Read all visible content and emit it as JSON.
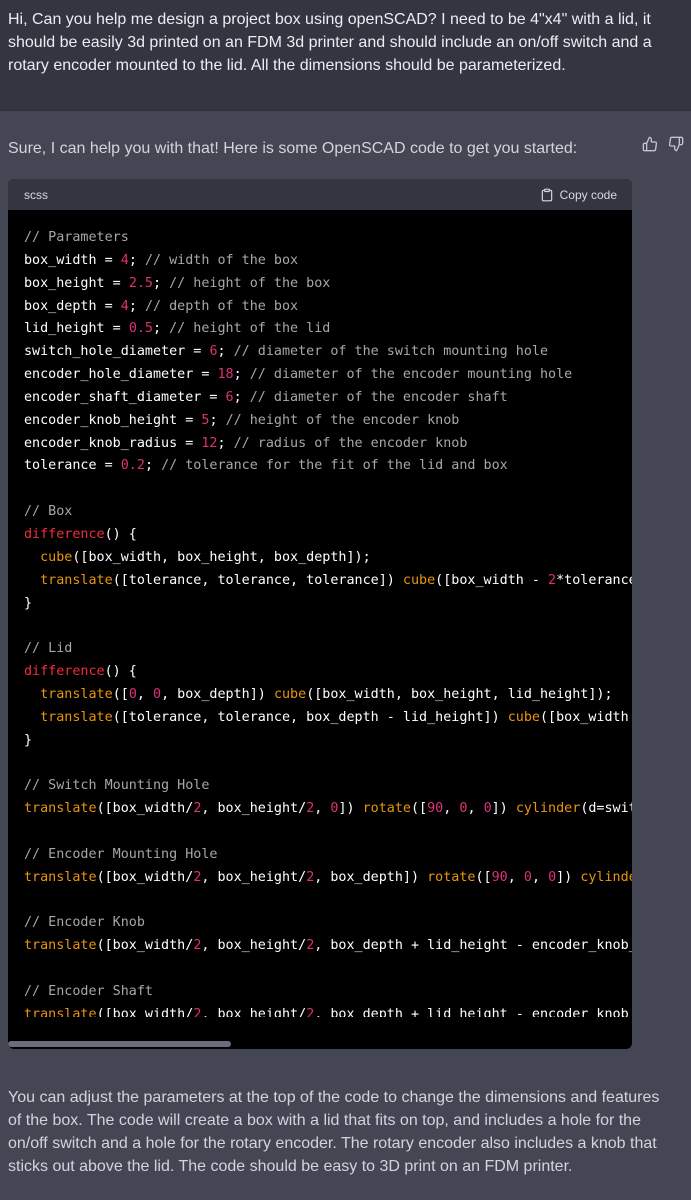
{
  "user_message": {
    "text": "Hi, Can you help me design a project box using openSCAD? I need to be 4\"x4\" with a lid, it should be easily 3d printed on an FDM 3d printer and should include an on/off switch and a rotary encoder mounted to the lid. All the dimensions should be parameterized."
  },
  "assistant": {
    "intro": "Sure, I can help you with that! Here is some OpenSCAD code to get you started:",
    "outro": "You can adjust the parameters at the top of the code to change the dimensions and features of the box. The code will create a box with a lid that fits on top, and includes a hole for the on/off switch and a hole for the rotary encoder. The rotary encoder also includes a knob that sticks out above the lid. The code should be easy to 3D print on an FDM printer."
  },
  "code_block": {
    "language": "scss",
    "copy_label": "Copy code",
    "lines": [
      [
        [
          "cm",
          "// Parameters"
        ]
      ],
      [
        [
          "t",
          "box_width = "
        ],
        [
          "num",
          "4"
        ],
        [
          "t",
          "; "
        ],
        [
          "cm",
          "// width of the box"
        ]
      ],
      [
        [
          "t",
          "box_height = "
        ],
        [
          "num",
          "2.5"
        ],
        [
          "t",
          "; "
        ],
        [
          "cm",
          "// height of the box"
        ]
      ],
      [
        [
          "t",
          "box_depth = "
        ],
        [
          "num",
          "4"
        ],
        [
          "t",
          "; "
        ],
        [
          "cm",
          "// depth of the box"
        ]
      ],
      [
        [
          "t",
          "lid_height = "
        ],
        [
          "num",
          "0.5"
        ],
        [
          "t",
          "; "
        ],
        [
          "cm",
          "// height of the lid"
        ]
      ],
      [
        [
          "t",
          "switch_hole_diameter = "
        ],
        [
          "num",
          "6"
        ],
        [
          "t",
          "; "
        ],
        [
          "cm",
          "// diameter of the switch mounting hole"
        ]
      ],
      [
        [
          "t",
          "encoder_hole_diameter = "
        ],
        [
          "num",
          "18"
        ],
        [
          "t",
          "; "
        ],
        [
          "cm",
          "// diameter of the encoder mounting hole"
        ]
      ],
      [
        [
          "t",
          "encoder_shaft_diameter = "
        ],
        [
          "num",
          "6"
        ],
        [
          "t",
          "; "
        ],
        [
          "cm",
          "// diameter of the encoder shaft"
        ]
      ],
      [
        [
          "t",
          "encoder_knob_height = "
        ],
        [
          "num",
          "5"
        ],
        [
          "t",
          "; "
        ],
        [
          "cm",
          "// height of the encoder knob"
        ]
      ],
      [
        [
          "t",
          "encoder_knob_radius = "
        ],
        [
          "num",
          "12"
        ],
        [
          "t",
          "; "
        ],
        [
          "cm",
          "// radius of the encoder knob"
        ]
      ],
      [
        [
          "t",
          "tolerance = "
        ],
        [
          "num",
          "0.2"
        ],
        [
          "t",
          "; "
        ],
        [
          "cm",
          "// tolerance for the fit of the lid and box"
        ]
      ],
      [],
      [
        [
          "cm",
          "// Box"
        ]
      ],
      [
        [
          "fn",
          "difference"
        ],
        [
          "t",
          "() {"
        ]
      ],
      [
        [
          "t",
          "  "
        ],
        [
          "call",
          "cube"
        ],
        [
          "t",
          "([box_width, box_height, box_depth]);"
        ]
      ],
      [
        [
          "t",
          "  "
        ],
        [
          "call",
          "translate"
        ],
        [
          "t",
          "([tolerance, tolerance, tolerance]) "
        ],
        [
          "call",
          "cube"
        ],
        [
          "t",
          "([box_width - "
        ],
        [
          "num",
          "2"
        ],
        [
          "t",
          "*tolerance"
        ]
      ],
      [
        [
          "t",
          "}"
        ]
      ],
      [],
      [
        [
          "cm",
          "// Lid"
        ]
      ],
      [
        [
          "fn",
          "difference"
        ],
        [
          "t",
          "() {"
        ]
      ],
      [
        [
          "t",
          "  "
        ],
        [
          "call",
          "translate"
        ],
        [
          "t",
          "(["
        ],
        [
          "num",
          "0"
        ],
        [
          "t",
          ", "
        ],
        [
          "num",
          "0"
        ],
        [
          "t",
          ", box_depth]) "
        ],
        [
          "call",
          "cube"
        ],
        [
          "t",
          "([box_width, box_height, lid_height]);"
        ]
      ],
      [
        [
          "t",
          "  "
        ],
        [
          "call",
          "translate"
        ],
        [
          "t",
          "([tolerance, tolerance, box_depth - lid_height]) "
        ],
        [
          "call",
          "cube"
        ],
        [
          "t",
          "([box_width"
        ]
      ],
      [
        [
          "t",
          "}"
        ]
      ],
      [],
      [
        [
          "cm",
          "// Switch Mounting Hole"
        ]
      ],
      [
        [
          "call",
          "translate"
        ],
        [
          "t",
          "([box_width/"
        ],
        [
          "num",
          "2"
        ],
        [
          "t",
          ", box_height/"
        ],
        [
          "num",
          "2"
        ],
        [
          "t",
          ", "
        ],
        [
          "num",
          "0"
        ],
        [
          "t",
          "]) "
        ],
        [
          "call",
          "rotate"
        ],
        [
          "t",
          "(["
        ],
        [
          "num",
          "90"
        ],
        [
          "t",
          ", "
        ],
        [
          "num",
          "0"
        ],
        [
          "t",
          ", "
        ],
        [
          "num",
          "0"
        ],
        [
          "t",
          "]) "
        ],
        [
          "call",
          "cylinder"
        ],
        [
          "t",
          "(d=swit"
        ]
      ],
      [],
      [
        [
          "cm",
          "// Encoder Mounting Hole"
        ]
      ],
      [
        [
          "call",
          "translate"
        ],
        [
          "t",
          "([box_width/"
        ],
        [
          "num",
          "2"
        ],
        [
          "t",
          ", box_height/"
        ],
        [
          "num",
          "2"
        ],
        [
          "t",
          ", box_depth]) "
        ],
        [
          "call",
          "rotate"
        ],
        [
          "t",
          "(["
        ],
        [
          "num",
          "90"
        ],
        [
          "t",
          ", "
        ],
        [
          "num",
          "0"
        ],
        [
          "t",
          ", "
        ],
        [
          "num",
          "0"
        ],
        [
          "t",
          "]) "
        ],
        [
          "call",
          "cylinde"
        ]
      ],
      [],
      [
        [
          "cm",
          "// Encoder Knob"
        ]
      ],
      [
        [
          "call",
          "translate"
        ],
        [
          "t",
          "([box_width/"
        ],
        [
          "num",
          "2"
        ],
        [
          "t",
          ", box_height/"
        ],
        [
          "num",
          "2"
        ],
        [
          "t",
          ", box_depth + lid_height - encoder_knob_"
        ]
      ],
      [],
      [
        [
          "cm",
          "// Encoder Shaft"
        ]
      ],
      [
        [
          "call",
          "translate"
        ],
        [
          "t",
          "([box_width/"
        ],
        [
          "num",
          "2"
        ],
        [
          "t",
          ", box_height/"
        ],
        [
          "num",
          "2"
        ],
        [
          "t",
          ", box_depth + lid_height - encoder_knob_"
        ]
      ]
    ]
  },
  "colors": {
    "background": "#444654",
    "user_background": "#343541",
    "code_background": "#000000",
    "comment": "#a7a7a7",
    "number": "#df3079",
    "keyword": "#f22c3d",
    "function": "#e9950c"
  },
  "icons": [
    "thumbs-up-icon",
    "thumbs-down-icon",
    "clipboard-icon"
  ]
}
